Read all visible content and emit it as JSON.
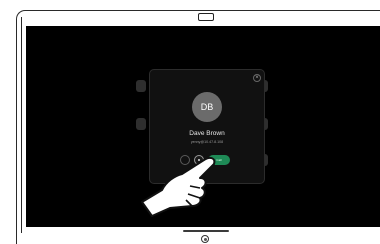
{
  "contact": {
    "initials": "DB",
    "name": "Dave Brown",
    "address": "yenny@10.47.8.108",
    "call_label": "Call"
  },
  "icons": {
    "close": "close-icon",
    "camera": "camera-icon",
    "home": "home-button-icon",
    "hand": "pointing-hand-icon"
  },
  "colors": {
    "screen": "#000000",
    "card": "#111111",
    "avatar": "#6b6b6b",
    "call_button": "#1e8a56"
  }
}
